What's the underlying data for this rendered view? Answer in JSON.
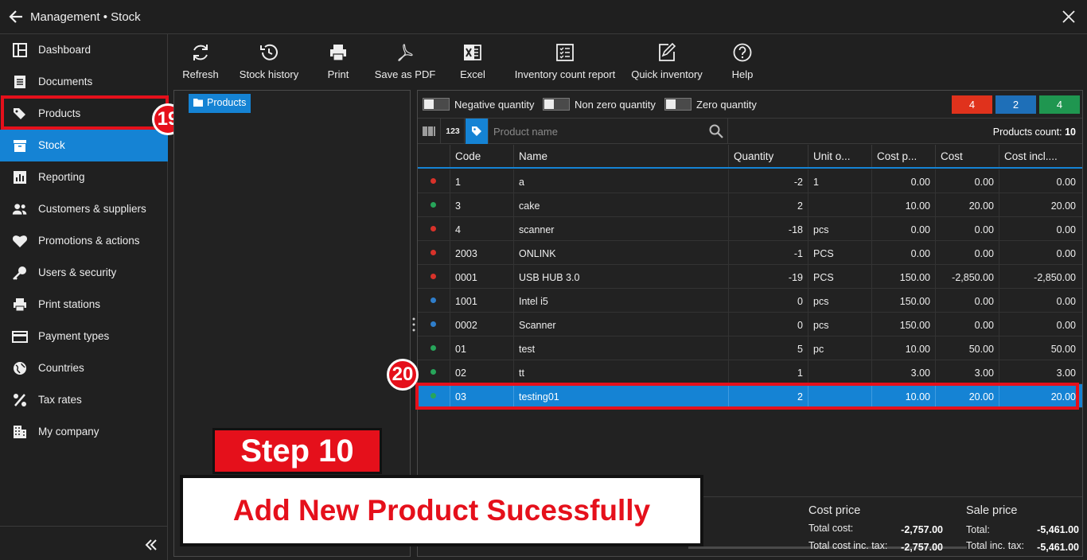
{
  "window": {
    "title": "Management • Stock"
  },
  "sidebar": {
    "items": [
      {
        "label": "Dashboard",
        "icon": "dashboard-icon"
      },
      {
        "label": "Documents",
        "icon": "documents-icon"
      },
      {
        "label": "Products",
        "icon": "tags-icon"
      },
      {
        "label": "Stock",
        "icon": "box-icon",
        "active": true
      },
      {
        "label": "Reporting",
        "icon": "chart-icon"
      },
      {
        "label": "Customers & suppliers",
        "icon": "users-icon"
      },
      {
        "label": "Promotions & actions",
        "icon": "heart-icon"
      },
      {
        "label": "Users & security",
        "icon": "key-icon"
      },
      {
        "label": "Print stations",
        "icon": "printer-icon"
      },
      {
        "label": "Payment types",
        "icon": "card-icon"
      },
      {
        "label": "Countries",
        "icon": "globe-icon"
      },
      {
        "label": "Tax rates",
        "icon": "percent-icon"
      },
      {
        "label": "My company",
        "icon": "building-icon"
      }
    ]
  },
  "annotations": {
    "badge_19": "19",
    "badge_20": "20",
    "step": "Step 10",
    "caption": "Add New Product Sucessfully"
  },
  "toolbar": {
    "refresh": "Refresh",
    "stock_history": "Stock history",
    "print": "Print",
    "save_pdf": "Save as PDF",
    "excel": "Excel",
    "inventory_report": "Inventory count report",
    "quick_inventory": "Quick inventory",
    "help": "Help"
  },
  "tree": {
    "root": "Products"
  },
  "filters": {
    "negative": "Negative quantity",
    "nonzero": "Non zero quantity",
    "zero": "Zero quantity",
    "counts": [
      {
        "value": "4",
        "color": "#e0321c"
      },
      {
        "value": "2",
        "color": "#1e6fb8"
      },
      {
        "value": "4",
        "color": "#1f9650"
      }
    ]
  },
  "search": {
    "code_btn": "123",
    "placeholder": "Product name",
    "count_label": "Products count:",
    "count_value": "10"
  },
  "grid": {
    "columns": [
      "Code",
      "Name",
      "Quantity",
      "Unit o...",
      "Cost p...",
      "Cost",
      "Cost incl...."
    ],
    "rows": [
      {
        "status": "#d8322a",
        "code": "1",
        "name": "a",
        "qty": "-2",
        "unit": "1",
        "costp": "0.00",
        "cost": "0.00",
        "costincl": "0.00"
      },
      {
        "status": "#27a55a",
        "code": "3",
        "name": "cake",
        "qty": "2",
        "unit": "",
        "costp": "10.00",
        "cost": "20.00",
        "costincl": "20.00"
      },
      {
        "status": "#d8322a",
        "code": "4",
        "name": "scanner",
        "qty": "-18",
        "unit": "pcs",
        "costp": "0.00",
        "cost": "0.00",
        "costincl": "0.00"
      },
      {
        "status": "#d8322a",
        "code": "2003",
        "name": "ONLINK",
        "qty": "-1",
        "unit": "PCS",
        "costp": "0.00",
        "cost": "0.00",
        "costincl": "0.00"
      },
      {
        "status": "#d8322a",
        "code": "0001",
        "name": "USB HUB 3.0",
        "qty": "-19",
        "unit": "PCS",
        "costp": "150.00",
        "cost": "-2,850.00",
        "costincl": "-2,850.00"
      },
      {
        "status": "#2f7ecb",
        "code": "1001",
        "name": "Intel i5",
        "qty": "0",
        "unit": "pcs",
        "costp": "150.00",
        "cost": "0.00",
        "costincl": "0.00"
      },
      {
        "status": "#2f7ecb",
        "code": "0002",
        "name": "Scanner",
        "qty": "0",
        "unit": "pcs",
        "costp": "150.00",
        "cost": "0.00",
        "costincl": "0.00"
      },
      {
        "status": "#27a55a",
        "code": "01",
        "name": "test",
        "qty": "5",
        "unit": "pc",
        "costp": "10.00",
        "cost": "50.00",
        "costincl": "50.00"
      },
      {
        "status": "#27a55a",
        "code": "02",
        "name": "tt",
        "qty": "1",
        "unit": "",
        "costp": "3.00",
        "cost": "3.00",
        "costincl": "3.00"
      },
      {
        "status": "#27a55a",
        "code": "03",
        "name": "testing01",
        "qty": "2",
        "unit": "",
        "costp": "10.00",
        "cost": "20.00",
        "costincl": "20.00",
        "selected": true
      }
    ]
  },
  "totals": {
    "cost_title": "Cost price",
    "total_cost_label": "Total cost:",
    "total_cost": "-2,757.00",
    "total_cost_tax_label": "Total cost inc. tax:",
    "total_cost_tax": "-2,757.00",
    "sale_title": "Sale price",
    "total_label": "Total:",
    "total": "-5,461.00",
    "total_tax_label": "Total inc. tax:",
    "total_tax": "-5,461.00"
  }
}
